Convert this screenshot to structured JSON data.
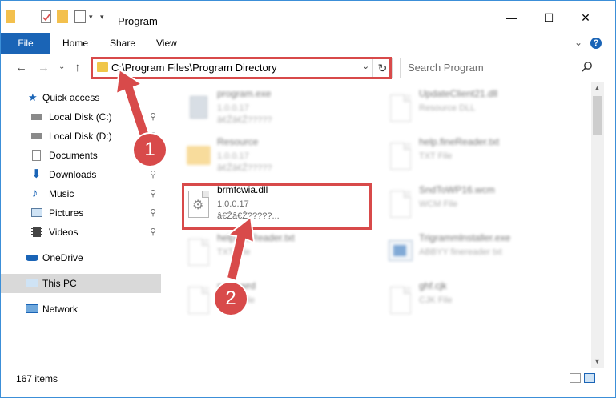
{
  "window": {
    "title": "Program",
    "minimize_glyph": "—",
    "maximize_glyph": "☐",
    "close_glyph": "✕"
  },
  "ribbon": {
    "tabs": [
      "File",
      "Home",
      "Share",
      "View"
    ],
    "expand_glyph": "⌄",
    "help_glyph": "?"
  },
  "address_bar": {
    "path": "C:\\Program Files\\Program Directory",
    "dropdown_glyph": "⌄",
    "refresh_glyph": "↻"
  },
  "search": {
    "placeholder": "Search Program",
    "icon": "search-icon"
  },
  "nav": {
    "back_glyph": "←",
    "forward_glyph": "→",
    "recent_glyph": "⌄",
    "up_glyph": "↑"
  },
  "sidebar": {
    "items": [
      {
        "label": "Quick access",
        "icon": "star-icon"
      },
      {
        "label": "Local Disk (C:)",
        "icon": "drive-icon",
        "pinned": true
      },
      {
        "label": "Local Disk (D:)",
        "icon": "drive-icon",
        "pinned": true
      },
      {
        "label": "Documents",
        "icon": "documents-icon",
        "pinned": true
      },
      {
        "label": "Downloads",
        "icon": "download-icon",
        "pinned": true
      },
      {
        "label": "Music",
        "icon": "music-icon",
        "pinned": true
      },
      {
        "label": "Pictures",
        "icon": "pictures-icon",
        "pinned": true
      },
      {
        "label": "Videos",
        "icon": "videos-icon",
        "pinned": true
      },
      {
        "label": "OneDrive",
        "icon": "cloud-icon"
      },
      {
        "label": "This PC",
        "icon": "computer-icon",
        "selected": true
      },
      {
        "label": "Network",
        "icon": "network-icon"
      }
    ],
    "pin_glyph": "📌"
  },
  "files": {
    "left": [
      {
        "name": "program.exe",
        "line1": "1.0.0.17",
        "line2": "â€Žâ€Ž?????"
      },
      {
        "name": "Resource",
        "line1": "1.0.0.17",
        "line2": "â€Žâ€Ž?????"
      },
      {
        "name": "brmfcwia.dll",
        "line1": "1.0.0.17",
        "line2": "â€Žâ€Ž?????..."
      },
      {
        "name": "helpfineReader.txt",
        "line1": "TXT File",
        "line2": ""
      },
      {
        "name": "spec.wrd",
        "line1": "WRD File",
        "line2": ""
      }
    ],
    "right": [
      {
        "name": "UpdateClient21.dll",
        "line1": "Resource DLL",
        "line2": ""
      },
      {
        "name": "help.fineReader.txt",
        "line1": "TXT File",
        "line2": ""
      },
      {
        "name": "SndToWP16.wcm",
        "line1": "WCM File",
        "line2": ""
      },
      {
        "name": "Trigrammlnstaller.exe",
        "line1": "ABBYY finereader txt",
        "line2": ""
      },
      {
        "name": "ghf.cjk",
        "line1": "CJK File",
        "line2": ""
      }
    ]
  },
  "status": {
    "item_count": "167 items"
  },
  "annotations": {
    "badge1": "1",
    "badge2": "2",
    "color": "#d84a4a"
  },
  "colors": {
    "file_tab": "#1a64b6",
    "selection": "#d9d9d9",
    "folder": "#f3c04d"
  }
}
